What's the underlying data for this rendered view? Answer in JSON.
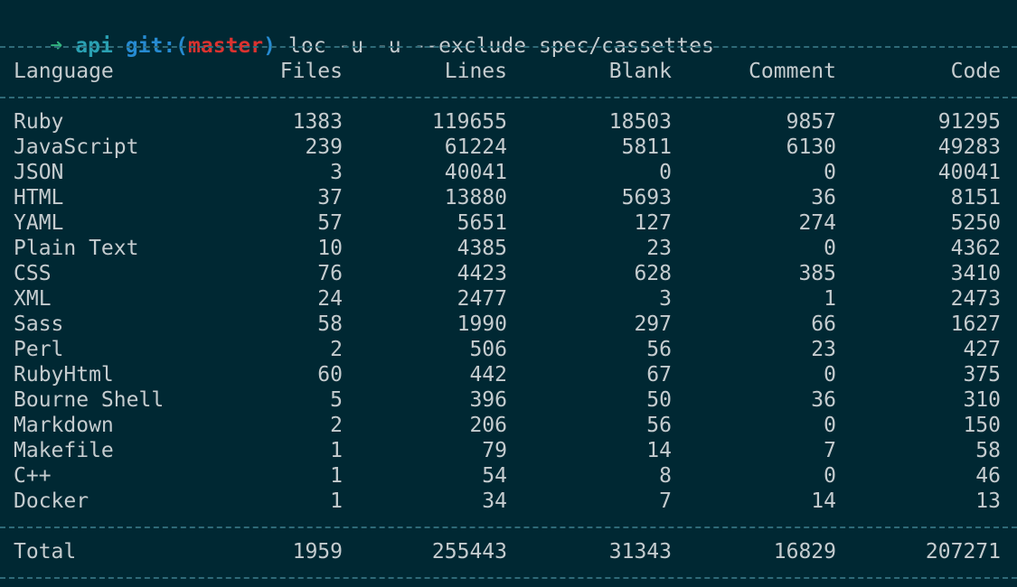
{
  "prompt": {
    "arrow": "➜",
    "directory": "api",
    "git_label": "git:(",
    "branch": "master",
    "git_close": ")",
    "command": "loc -u -u --exclude spec/cassettes"
  },
  "colors": {
    "background": "#002833",
    "text": "#c5cccf",
    "arrow": "#31b27e",
    "directory": "#2aa1b3",
    "git_label": "#268bd2",
    "branch": "#dc322f",
    "separator": "#2f6a78"
  },
  "table": {
    "headers": {
      "language": "Language",
      "files": "Files",
      "lines": "Lines",
      "blank": "Blank",
      "comment": "Comment",
      "code": "Code"
    },
    "rows": [
      {
        "language": "Ruby",
        "files": "1383",
        "lines": "119655",
        "blank": "18503",
        "comment": "9857",
        "code": "91295"
      },
      {
        "language": "JavaScript",
        "files": "239",
        "lines": "61224",
        "blank": "5811",
        "comment": "6130",
        "code": "49283"
      },
      {
        "language": "JSON",
        "files": "3",
        "lines": "40041",
        "blank": "0",
        "comment": "0",
        "code": "40041"
      },
      {
        "language": "HTML",
        "files": "37",
        "lines": "13880",
        "blank": "5693",
        "comment": "36",
        "code": "8151"
      },
      {
        "language": "YAML",
        "files": "57",
        "lines": "5651",
        "blank": "127",
        "comment": "274",
        "code": "5250"
      },
      {
        "language": "Plain Text",
        "files": "10",
        "lines": "4385",
        "blank": "23",
        "comment": "0",
        "code": "4362"
      },
      {
        "language": "CSS",
        "files": "76",
        "lines": "4423",
        "blank": "628",
        "comment": "385",
        "code": "3410"
      },
      {
        "language": "XML",
        "files": "24",
        "lines": "2477",
        "blank": "3",
        "comment": "1",
        "code": "2473"
      },
      {
        "language": "Sass",
        "files": "58",
        "lines": "1990",
        "blank": "297",
        "comment": "66",
        "code": "1627"
      },
      {
        "language": "Perl",
        "files": "2",
        "lines": "506",
        "blank": "56",
        "comment": "23",
        "code": "427"
      },
      {
        "language": "RubyHtml",
        "files": "60",
        "lines": "442",
        "blank": "67",
        "comment": "0",
        "code": "375"
      },
      {
        "language": "Bourne Shell",
        "files": "5",
        "lines": "396",
        "blank": "50",
        "comment": "36",
        "code": "310"
      },
      {
        "language": "Markdown",
        "files": "2",
        "lines": "206",
        "blank": "56",
        "comment": "0",
        "code": "150"
      },
      {
        "language": "Makefile",
        "files": "1",
        "lines": "79",
        "blank": "14",
        "comment": "7",
        "code": "58"
      },
      {
        "language": "C++",
        "files": "1",
        "lines": "54",
        "blank": "8",
        "comment": "0",
        "code": "46"
      },
      {
        "language": "Docker",
        "files": "1",
        "lines": "34",
        "blank": "7",
        "comment": "14",
        "code": "13"
      }
    ],
    "total": {
      "language": "Total",
      "files": "1959",
      "lines": "255443",
      "blank": "31343",
      "comment": "16829",
      "code": "207271"
    }
  }
}
